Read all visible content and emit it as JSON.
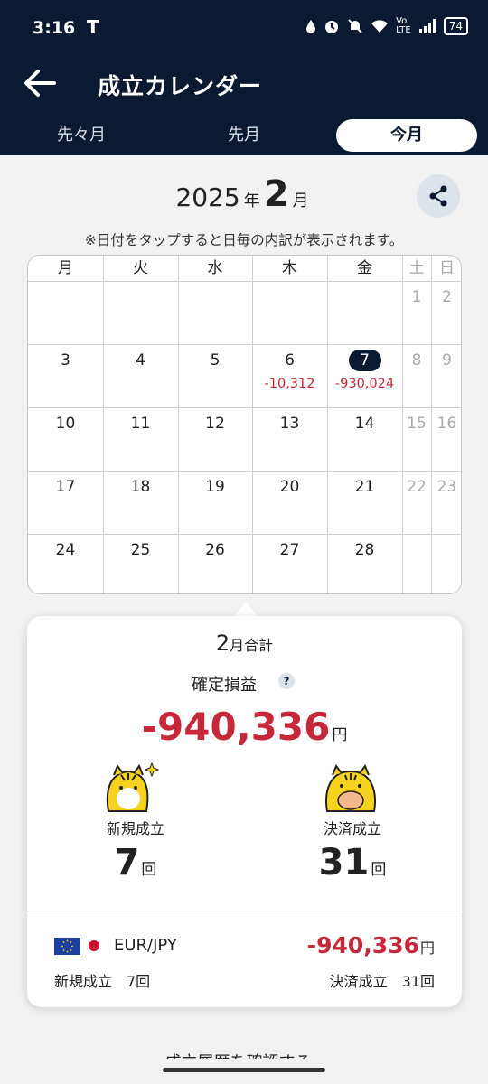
{
  "status_bar": {
    "time": "3:16",
    "battery": "74",
    "icons": [
      "drop-icon",
      "alarm-icon",
      "mute-icon",
      "wifi-icon",
      "volte-icon",
      "signal-icon",
      "battery-icon"
    ]
  },
  "header": {
    "title": "成立カレンダー",
    "tabs": [
      {
        "label": "先々月",
        "selected": false
      },
      {
        "label": "先月",
        "selected": false
      },
      {
        "label": "今月",
        "selected": true
      }
    ]
  },
  "month": {
    "year": "2025",
    "year_unit": "年",
    "month": "2",
    "month_unit": "月"
  },
  "hint": "※日付をタップすると日毎の内訳が表示されます。",
  "calendar": {
    "weekdays": [
      "月",
      "火",
      "水",
      "木",
      "金",
      "土",
      "日"
    ],
    "weeks": [
      [
        "",
        "",
        "",
        "",
        "",
        "1",
        "2"
      ],
      [
        "3",
        "4",
        "5",
        "6",
        "7",
        "8",
        "9"
      ],
      [
        "10",
        "11",
        "12",
        "13",
        "14",
        "15",
        "16"
      ],
      [
        "17",
        "18",
        "19",
        "20",
        "21",
        "22",
        "23"
      ],
      [
        "24",
        "25",
        "26",
        "27",
        "28",
        "",
        ""
      ]
    ],
    "selected_day": "7",
    "amounts": {
      "6": "-10,312",
      "7": "-930,024"
    }
  },
  "summary": {
    "month_num": "2",
    "month_total_label": "月合計",
    "pl_label": "確定損益",
    "help": "?",
    "pl_value": "-940,336",
    "yen": "円",
    "new_label": "新規成立",
    "new_count": "7",
    "settle_label": "決済成立",
    "settle_count": "31",
    "count_unit": "回"
  },
  "pairs": [
    {
      "name": "EUR/JPY",
      "pl": "-940,336",
      "yen": "円",
      "new_text": "新規成立　7回",
      "settle_text": "決済成立　31回"
    }
  ],
  "history_link": "成立履歴を確認する ›",
  "colors": {
    "navy": "#0b1a33",
    "loss_red": "#c62839",
    "tiger_yellow": "#f7d21e"
  }
}
